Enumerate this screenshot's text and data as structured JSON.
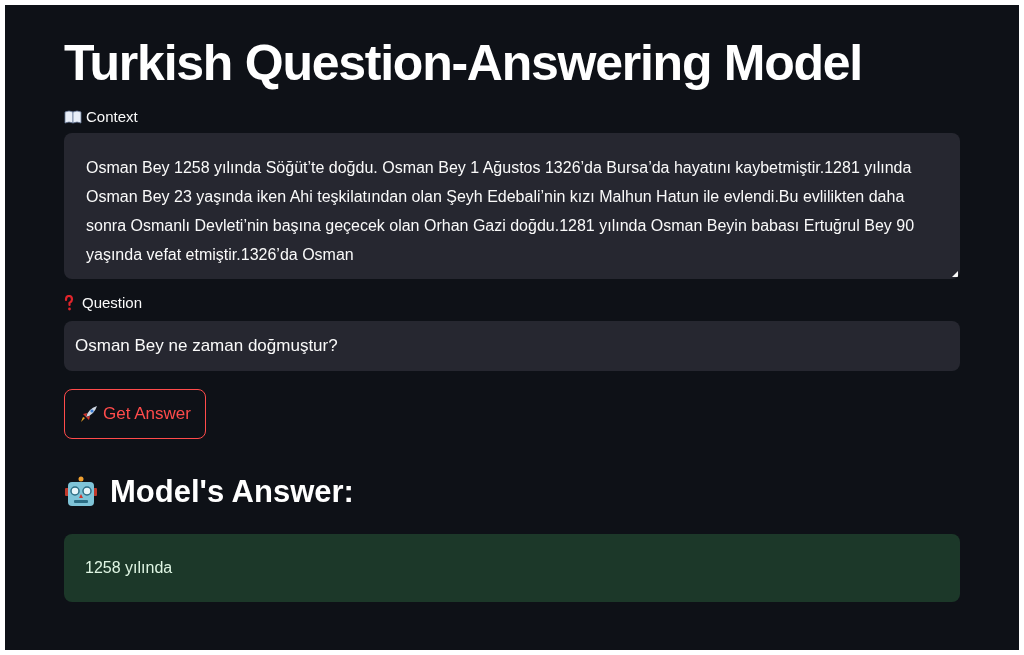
{
  "title": "Turkish Question-Answering Model",
  "context": {
    "label": "Context",
    "value": "Osman Bey 1258 yılında Söğüt’te doğdu. Osman Bey 1 Ağustos 1326’da Bursa’da hayatını kaybetmiştir.1281 yılında Osman Bey 23 yaşında iken Ahi teşkilatından olan Şeyh Edebali’nin kızı Malhun Hatun ile evlendi.Bu evlilikten daha sonra Osmanlı Devleti’nin başına geçecek olan Orhan Gazi doğdu.1281 yılında Osman Beyin babası Ertuğrul Bey 90 yaşında  vefat etmiştir.1326’da Osman"
  },
  "question": {
    "label": "Question",
    "value": "Osman Bey ne zaman doğmuştur?"
  },
  "button": {
    "label": "Get Answer"
  },
  "answer": {
    "heading": "Model's Answer:",
    "value": "1258 yılında"
  }
}
